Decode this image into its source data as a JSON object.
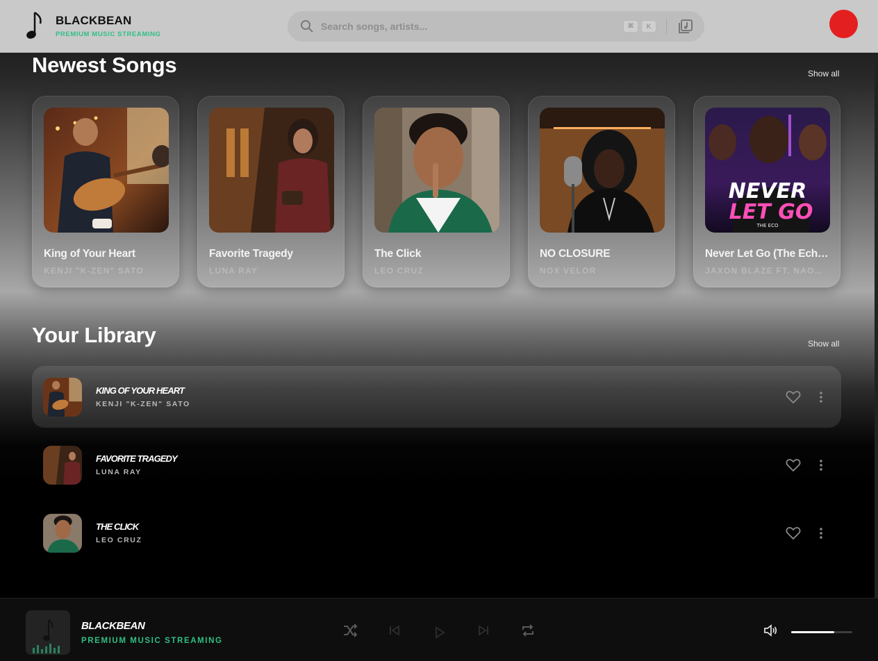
{
  "brand": {
    "name": "BLACKBEAN",
    "tagline": "PREMIUM MUSIC STREAMING"
  },
  "search": {
    "placeholder": "Search songs, artists...",
    "shortcut_keys": [
      "⌘",
      "K"
    ]
  },
  "colors": {
    "accent": "#2fbf87",
    "avatar": "#e41f1f",
    "header_bg": "#c9c9c9"
  },
  "sections": {
    "newest": {
      "title": "Newest Songs",
      "show_all": "Show all"
    },
    "library": {
      "title": "Your Library",
      "show_all": "Show all"
    }
  },
  "newest_songs": [
    {
      "title": "King of Your Heart",
      "artist": "KENJI \"K-ZEN\" SATO"
    },
    {
      "title": "Favorite Tragedy",
      "artist": "LUNA RAY"
    },
    {
      "title": "The Click",
      "artist": "LEO CRUZ"
    },
    {
      "title": "NO CLOSURE",
      "artist": "NOX VELOR"
    },
    {
      "title": "Never Let Go (The Echo Remix)",
      "artist": "JAXON BLAZE FT. NAOMI VEGA",
      "cover_text": "NEVER LET GO",
      "cover_subtext": "THE ECO"
    }
  ],
  "library": [
    {
      "title": "King of Your Heart",
      "artist": "KENJI \"K-ZEN\" SATO",
      "active": true
    },
    {
      "title": "Favorite Tragedy",
      "artist": "LUNA RAY",
      "active": false
    },
    {
      "title": "The Click",
      "artist": "LEO CRUZ",
      "active": false
    }
  ],
  "player": {
    "title": "BLACKBEAN",
    "subtitle": "PREMIUM MUSIC STREAMING",
    "volume": 0.7,
    "controls": [
      "shuffle-icon",
      "previous-icon",
      "play-icon",
      "next-icon",
      "repeat-icon"
    ]
  }
}
